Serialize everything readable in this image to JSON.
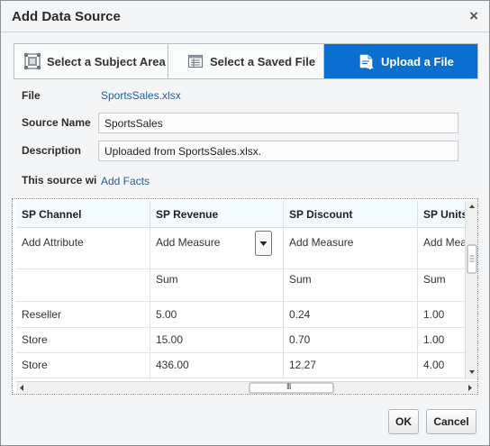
{
  "dialog": {
    "title": "Add Data Source",
    "close_glyph": "×"
  },
  "tabs": [
    {
      "label": "Select a Subject Area",
      "icon": "subject-area-icon",
      "selected": false
    },
    {
      "label": "Select a Saved File",
      "icon": "saved-file-icon",
      "selected": false
    },
    {
      "label": "Upload a File",
      "icon": "upload-file-icon",
      "selected": true
    }
  ],
  "form": {
    "file_label": "File",
    "file_value": "SportsSales.xlsx",
    "source_name_label": "Source Name",
    "source_name_value": "SportsSales",
    "description_label": "Description",
    "description_value": "Uploaded from SportsSales.xlsx.",
    "source_info_label": "This source wi",
    "add_facts_link": "Add Facts"
  },
  "table": {
    "columns": [
      {
        "header": "SP Channel",
        "role": "Add Attribute",
        "aggregation": ""
      },
      {
        "header": "SP Revenue",
        "role": "Add Measure",
        "aggregation": "Sum"
      },
      {
        "header": "SP Discount",
        "role": "Add Measure",
        "aggregation": "Sum"
      },
      {
        "header": "SP Units",
        "role": "Add Mea",
        "aggregation": "Sum"
      }
    ],
    "rows": [
      [
        "Reseller",
        "5.00",
        "0.24",
        "1.00"
      ],
      [
        "Store",
        "15.00",
        "0.70",
        "1.00"
      ],
      [
        "Store",
        "436.00",
        "12.27",
        "4.00"
      ]
    ],
    "hscroll_grip": "III"
  },
  "buttons": {
    "ok": "OK",
    "cancel": "Cancel"
  },
  "colors": {
    "selected_tab": "#0b6fd0",
    "link": "#1f5fa8",
    "header_bg": "#f2fbff"
  }
}
